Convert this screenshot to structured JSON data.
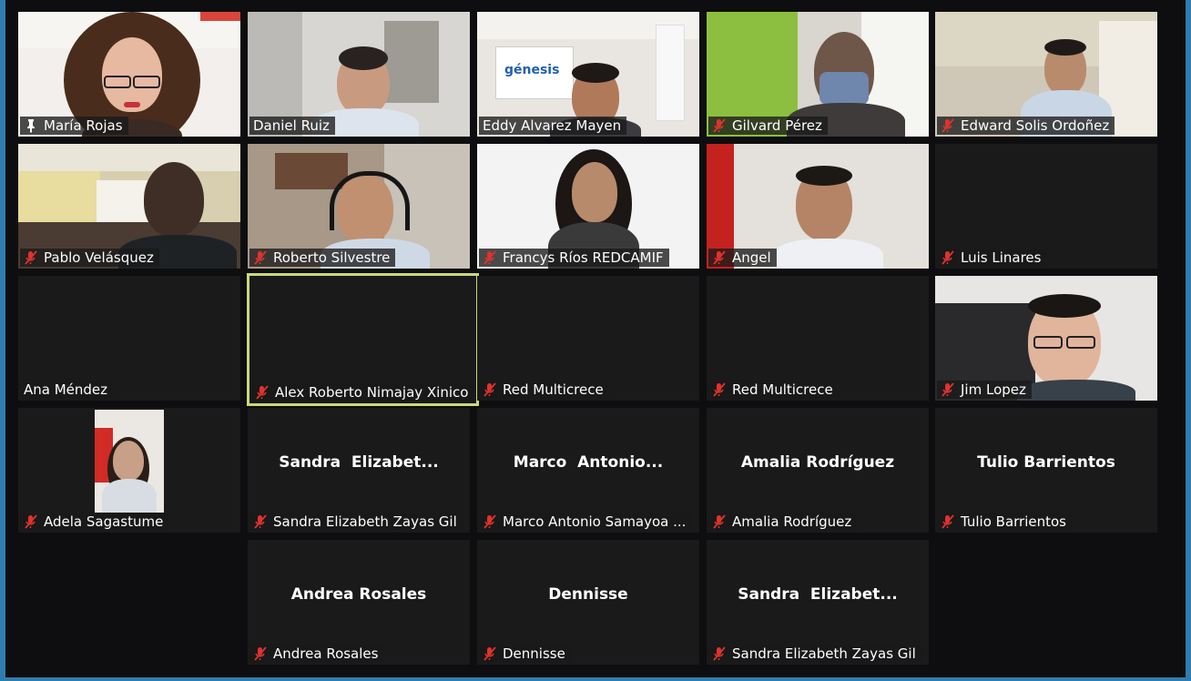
{
  "participants": [
    {
      "name": "María Rojas",
      "muted": false,
      "pinned": true,
      "video": true
    },
    {
      "name": "Daniel Ruiz",
      "muted": false,
      "pinned": false,
      "video": true
    },
    {
      "name": "Eddy Alvarez Mayen",
      "muted": false,
      "pinned": false,
      "video": true,
      "backdrop_logo": "génesis"
    },
    {
      "name": "Gilvard Pérez",
      "muted": true,
      "video": true
    },
    {
      "name": "Edward Solis Ordoñez",
      "muted": true,
      "video": true
    },
    {
      "name": "Pablo Velásquez",
      "muted": true,
      "video": true
    },
    {
      "name": "Roberto Silvestre",
      "muted": true,
      "video": true
    },
    {
      "name": "Francys Ríos REDCAMIF",
      "muted": true,
      "video": true
    },
    {
      "name": "Angel",
      "muted": true,
      "video": true
    },
    {
      "name": "Luis Linares",
      "muted": true,
      "video": false
    },
    {
      "name": "Ana Méndez",
      "muted": false,
      "video": false
    },
    {
      "name": "Alex Roberto Nimajay Xinico",
      "muted": true,
      "video": false,
      "active_speaker": true
    },
    {
      "name": "Red Multicrece",
      "muted": true,
      "video": false
    },
    {
      "name": "Red Multicrece",
      "muted": true,
      "video": false
    },
    {
      "name": "Jim Lopez",
      "muted": true,
      "video": true
    },
    {
      "name": "Adela Sagastume",
      "muted": true,
      "video": true
    },
    {
      "name": "Sandra Elizabeth Zayas Gil",
      "muted": true,
      "video": false,
      "display_name": "Sandra  Elizabet..."
    },
    {
      "name": "Marco Antonio Samayoa ...",
      "muted": true,
      "video": false,
      "display_name": "Marco  Antonio..."
    },
    {
      "name": "Amalia Rodríguez",
      "muted": true,
      "video": false,
      "display_name": "Amalia Rodríguez"
    },
    {
      "name": "Tulio Barrientos",
      "muted": true,
      "video": false,
      "display_name": "Tulio Barrientos"
    },
    {
      "name": "Andrea Rosales",
      "muted": true,
      "video": false,
      "display_name": "Andrea Rosales"
    },
    {
      "name": "Dennisse",
      "muted": true,
      "video": false,
      "display_name": "Dennisse"
    },
    {
      "name": "Sandra Elizabeth Zayas Gil",
      "muted": true,
      "video": false,
      "display_name": "Sandra  Elizabet..."
    }
  ],
  "colors": {
    "frame": "#2f7dae",
    "background": "#0e0e10",
    "tile": "#1a1a1a",
    "active_border": "#cbd97a",
    "muted_icon": "#e0322d"
  },
  "icons": {
    "muted": "mic-muted-icon",
    "pinned": "pin-icon"
  }
}
